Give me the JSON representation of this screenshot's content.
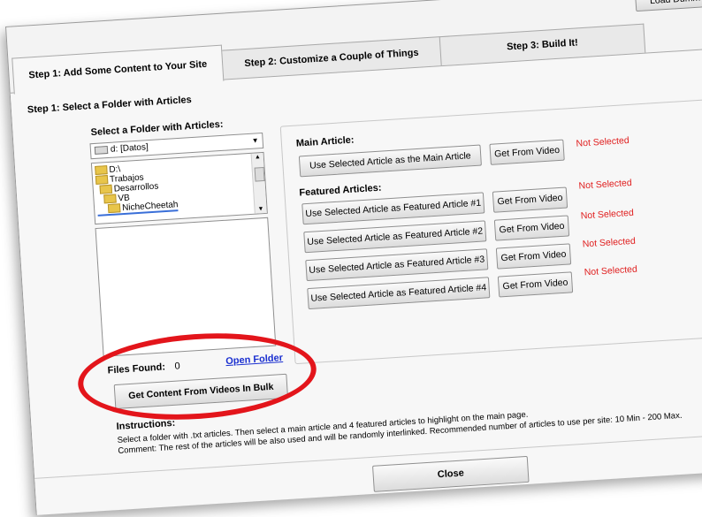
{
  "toolbar": {
    "load_dummy_label": "Load Dumm"
  },
  "tabs": [
    {
      "label": "Step 1: Add Some Content to Your Site"
    },
    {
      "label": "Step 2: Customize a Couple of Things"
    },
    {
      "label": "Step 3: Build It!"
    }
  ],
  "step1": {
    "section_title": "Step 1: Select a Folder with Articles",
    "select_folder_label": "Select a Folder with Articles:",
    "drive_value": "d: [Datos]",
    "folders": [
      "D:\\",
      "Trabajos",
      "Desarrollos",
      "VB",
      "NicheCheetah"
    ],
    "files_found_label": "Files Found:",
    "files_found_count": "0",
    "open_folder_link": "Open Folder",
    "bulk_button": "Get Content From Videos In Bulk",
    "main_article_label": "Main Article:",
    "main_article_button": "Use Selected Article as the Main Article",
    "get_from_video": "Get From Video",
    "not_selected": "Not Selected",
    "featured_label": "Featured Articles:",
    "featured_buttons": [
      "Use Selected Article as Featured Article #1",
      "Use Selected Article as Featured Article #2",
      "Use Selected Article as Featured Article #3",
      "Use Selected Article as Featured Article #4"
    ],
    "instructions_label": "Instructions:",
    "instructions_line1": "Select a folder with .txt articles. Then select a main article and 4 featured articles to highlight on the main page.",
    "instructions_line2": "Comment: The rest of the articles will be also used and will be randomly interlinked.  Recommended number of articles to use per site: 10 Min - 200 Max."
  },
  "footer": {
    "close_button": "Close"
  },
  "colors": {
    "status_red": "#e02020",
    "link_blue": "#1a2fd0",
    "highlight": "#e3151b"
  }
}
